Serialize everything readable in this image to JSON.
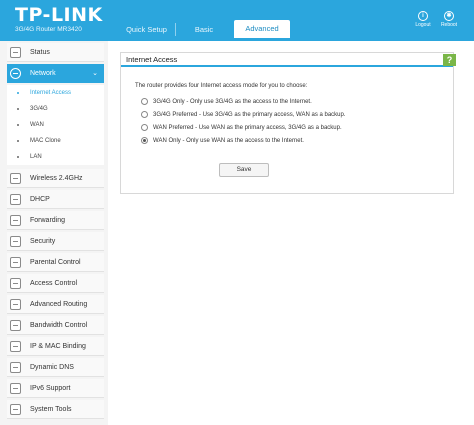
{
  "header": {
    "logo": "TP-LINK",
    "model": "3G/4G Router MR3420",
    "tabs": [
      {
        "label": "Quick Setup"
      },
      {
        "label": "Basic"
      },
      {
        "label": "Advanced"
      }
    ],
    "active_tab": "Advanced",
    "logout_label": "Logout",
    "reboot_label": "Reboot",
    "accent_color": "#2ba6dd"
  },
  "sidebar": {
    "items": [
      {
        "label": "Status",
        "icon": "status-icon"
      },
      {
        "label": "Network",
        "icon": "globe-icon",
        "active": true
      },
      {
        "label": "Wireless 2.4GHz",
        "icon": "wireless-icon"
      },
      {
        "label": "DHCP",
        "icon": "dhcp-icon"
      },
      {
        "label": "Forwarding",
        "icon": "forwarding-icon"
      },
      {
        "label": "Security",
        "icon": "shield-icon"
      },
      {
        "label": "Parental Control",
        "icon": "parental-control-icon"
      },
      {
        "label": "Access Control",
        "icon": "access-control-icon"
      },
      {
        "label": "Advanced Routing",
        "icon": "routing-icon"
      },
      {
        "label": "Bandwidth Control",
        "icon": "bandwidth-icon"
      },
      {
        "label": "IP & MAC Binding",
        "icon": "binding-icon"
      },
      {
        "label": "Dynamic DNS",
        "icon": "dns-icon"
      },
      {
        "label": "IPv6 Support",
        "icon": "ipv6-icon"
      },
      {
        "label": "System Tools",
        "icon": "tools-icon"
      }
    ],
    "network_sub": [
      {
        "label": "Internet Access",
        "active": true
      },
      {
        "label": "3G/4G"
      },
      {
        "label": "WAN"
      },
      {
        "label": "MAC Clone"
      },
      {
        "label": "LAN"
      }
    ]
  },
  "main": {
    "panel_title": "Internet Access",
    "help_label": "?",
    "intro": "The router provides four Internet access mode for you to choose:",
    "options": [
      {
        "label": "3G/4G Only - Only use 3G/4G as the access to the Internet.",
        "selected": false
      },
      {
        "label": "3G/4G Preferred - Use 3G/4G as the primary access, WAN as a backup.",
        "selected": false
      },
      {
        "label": "WAN Preferred - Use WAN as the primary access, 3G/4G as a backup.",
        "selected": false
      },
      {
        "label": "WAN Only - Only use WAN as the access to the Internet.",
        "selected": true
      }
    ],
    "save_label": "Save"
  }
}
